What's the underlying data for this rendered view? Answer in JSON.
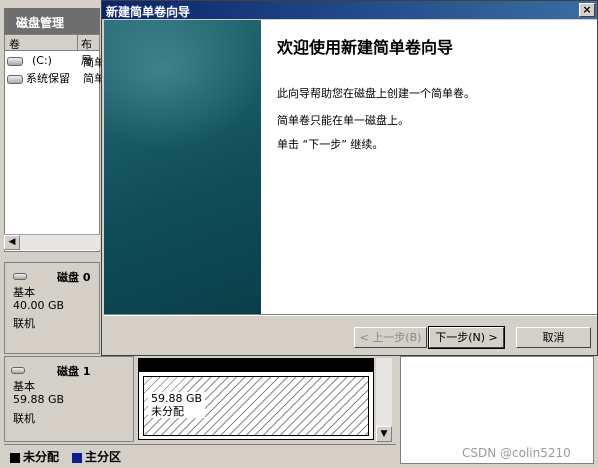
{
  "disk_management": {
    "title": "磁盘管理",
    "columns": [
      "卷",
      "布局"
    ],
    "volumes": [
      {
        "name": "(C:)",
        "layout": "简单"
      },
      {
        "name": "系统保留",
        "layout": "简单"
      }
    ],
    "disks": [
      {
        "name": "磁盘 0",
        "type": "基本",
        "size": "40.00 GB",
        "status": "联机"
      },
      {
        "name": "磁盘 1",
        "type": "基本",
        "size": "59.88 GB",
        "status": "联机"
      }
    ],
    "unallocated": {
      "size": "59.88 GB",
      "label": "未分配"
    },
    "legend": [
      {
        "label": "未分配",
        "color": "#000000"
      },
      {
        "label": "主分区",
        "color": "#0a1f8f"
      }
    ]
  },
  "wizard": {
    "title": "新建简单卷向导",
    "heading": "欢迎使用新建简单卷向导",
    "paragraphs": [
      "此向导帮助您在磁盘上创建一个简单卷。",
      "简单卷只能在单一磁盘上。",
      "单击 “下一步” 继续。"
    ],
    "buttons": {
      "back": "< 上一步(B)",
      "next": "下一步(N) >",
      "cancel": "取消"
    },
    "close": "×"
  },
  "watermark": "CSDN @colin5210",
  "colors": {
    "title_bar": "#0a246a",
    "side_panel": "#1b5c66",
    "chrome": "#d4d0c8"
  }
}
